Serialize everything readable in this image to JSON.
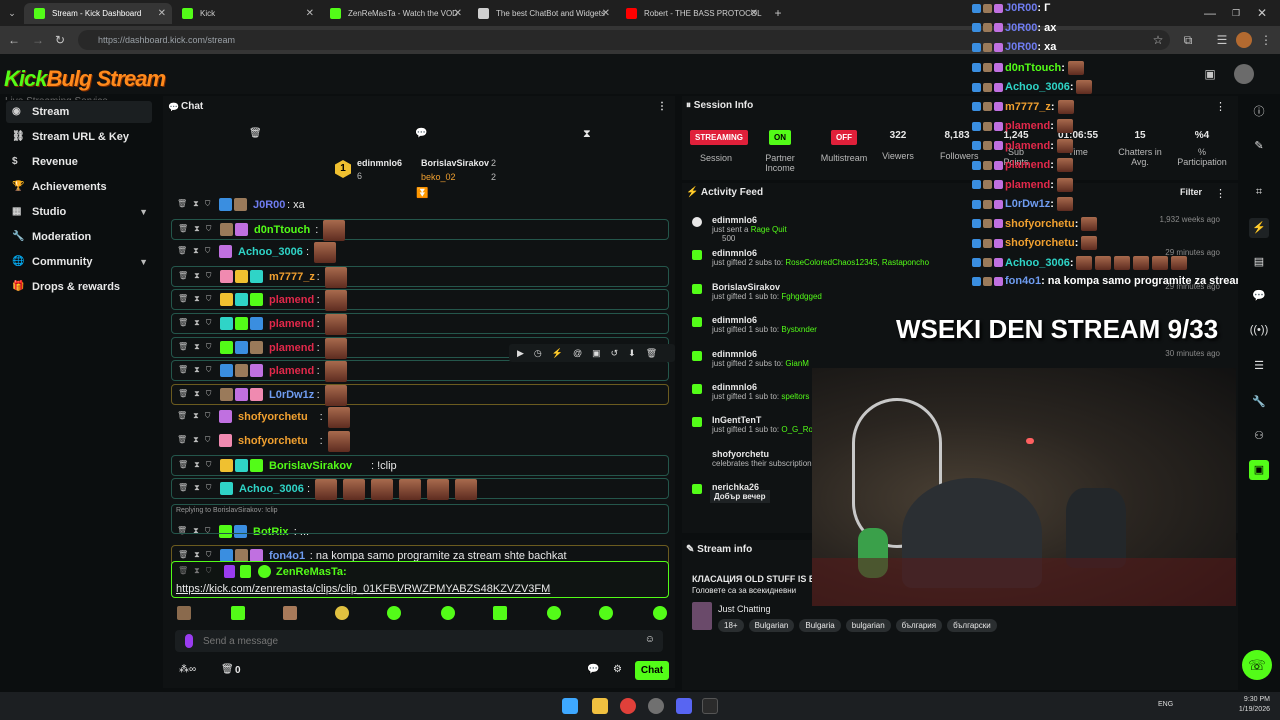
{
  "browser": {
    "tabs": [
      {
        "label": "Stream - Kick Dashboard",
        "color": "#53fc18"
      },
      {
        "label": "Kick",
        "color": "#53fc18"
      },
      {
        "label": "ZenReMasTa - Watch the VOD",
        "color": "#53fc18"
      },
      {
        "label": "The best ChatBot and Widgets",
        "color": "#d0d0d0"
      },
      {
        "label": "Robert - THE BASS PROTOCOL",
        "color": "#ff0000"
      }
    ],
    "url": "https://dashboard.kick.com/stream"
  },
  "app": {
    "logo_kick": "Kick",
    "logo_rest": "Bulg  Stream",
    "logo_sub": "Live Streaming Service"
  },
  "sidebar": {
    "items": [
      {
        "label": "Stream",
        "icon": "radio-icon"
      },
      {
        "label": "Stream URL & Key",
        "icon": "link-icon"
      },
      {
        "label": "Revenue",
        "icon": "dollar-icon"
      },
      {
        "label": "Achievements",
        "icon": "trophy-icon"
      },
      {
        "label": "Studio",
        "icon": "studio-icon"
      },
      {
        "label": "Moderation",
        "icon": "wrench-icon"
      },
      {
        "label": "Community",
        "icon": "globe-icon"
      },
      {
        "label": "Drops & rewards",
        "icon": "gift-icon"
      }
    ]
  },
  "chat": {
    "title": "Chat",
    "leader1_name": "edinmnlo6",
    "leader1_count": "6",
    "leader1_rank": "1",
    "leader2_name": "BorislavSirakov",
    "leader2_count": "2",
    "leader3_name": "beko_02",
    "leader3_count": "2",
    "messages": [
      {
        "name": "J0R00",
        "color": "#6f7cf0",
        "text": ": xa"
      },
      {
        "name": "d0nTtouch",
        "color": "#53fc18",
        "text": ":"
      },
      {
        "name": "Achoo_3006",
        "color": "#2fd4c7",
        "text": ":"
      },
      {
        "name": "m7777_z",
        "color": "#f0a030",
        "text": ":"
      },
      {
        "name": "plamend",
        "color": "#e0284a",
        "text": ":"
      },
      {
        "name": "plamend",
        "color": "#e0284a",
        "text": ":"
      },
      {
        "name": "plamend",
        "color": "#e0284a",
        "text": ":"
      },
      {
        "name": "plamend",
        "color": "#e0284a",
        "text": ":"
      },
      {
        "name": "L0rDw1z",
        "color": "#6f9cf0",
        "text": ":"
      },
      {
        "name": "shofyorchetu",
        "color": "#f0a030",
        "text": ":"
      },
      {
        "name": "shofyorchetu",
        "color": "#f0a030",
        "text": ":"
      },
      {
        "name": "BorislavSirakov",
        "color": "#53fc18",
        "text": ": !clip"
      },
      {
        "name": "Achoo_3006",
        "color": "#2fd4c7",
        "text": ":"
      },
      {
        "name": "BotRix",
        "color": "#53fc18",
        "text": ": ..."
      },
      {
        "name": "fon4o1",
        "color": "#6f9cf0",
        "text": ": na kompa samo programite za stream shte bachkat"
      }
    ],
    "reply_to": "Replying to BorislavSirakov: !clip",
    "last_name": "ZenReMasTa:",
    "last_link": "https://kick.com/zenremasta/clips/clip_01KFBVRWZPMYABZS48KZVZV3FM",
    "input_placeholder": "Send a message",
    "footer_count": "0",
    "chat_button": "Chat"
  },
  "session": {
    "title": "Session Info",
    "streaming_label": "STREAMING",
    "session_label": "Session",
    "on_label": "ON",
    "partner_label": "Partner Income",
    "off_label": "OFF",
    "multistream_label": "Multistream",
    "viewers_value": "322",
    "viewers_label": "Viewers",
    "followers_value": "8,183",
    "followers_label": "Followers",
    "subs_value": "1,245",
    "subs_label": "Sub Points",
    "time_value": "01:06:55",
    "time_label": "Time",
    "chatters_value": "15",
    "chatters_label": "Chatters in Avg.",
    "part_value": "%4",
    "part_label": "% Participation"
  },
  "activity": {
    "title": "Activity Feed",
    "filter_label": "Filter",
    "items": [
      {
        "who": "edinmnlo6",
        "what": "just sent a ",
        "target": "Rage Quit",
        "extra": "500",
        "when": "1,932 weeks ago"
      },
      {
        "who": "edinmnlo6",
        "what": "just gifted 2 subs to: ",
        "target": "RoseColoredChaos12345, Rastaponcho",
        "when": "29 minutes ago"
      },
      {
        "who": "BorislavSirakov",
        "what": "just gifted 1 sub to: ",
        "target": "Fghgdgged",
        "when": "29 minutes ago"
      },
      {
        "who": "edinmnlo6",
        "what": "just gifted 1 sub to: ",
        "target": "Bystxnder",
        "when": ""
      },
      {
        "who": "edinmnlo6",
        "what": "just gifted 2 subs to: ",
        "target": "GianM",
        "when": "30 minutes ago"
      },
      {
        "who": "edinmnlo6",
        "what": "just gifted 1 sub to: ",
        "target": "speltors",
        "when": ""
      },
      {
        "who": "InGentTenT",
        "what": "just gifted 1 sub to: ",
        "target": "O_G_Roc",
        "when": ""
      },
      {
        "who": "shofyorchetu",
        "what": "celebrates their subscription",
        "target": "",
        "when": ""
      },
      {
        "who": "nerichka26",
        "what": "",
        "target": "",
        "when": ""
      }
    ],
    "celebrate_msg": "Добър вечер"
  },
  "streaminfo": {
    "title": "Stream info",
    "line1": "КЛАСАЦИЯ OLD STUFF IS B",
    "line2": "Головете са за всекидневни",
    "category": "Just Chatting",
    "tags": [
      "18+",
      "Bulgarian",
      "Bulgaria",
      "bulgarian",
      "българия",
      "български"
    ]
  },
  "overlay": {
    "title": "WSEKI DEN STREAM 9/33",
    "chat": [
      {
        "name": "J0R00",
        "text": ": Г",
        "color": "#6f7cf0",
        "emotes": 0
      },
      {
        "name": "J0R00",
        "text": ": ах",
        "color": "#6f7cf0",
        "emotes": 0
      },
      {
        "name": "J0R00",
        "text": ": xa",
        "color": "#6f7cf0",
        "emotes": 0
      },
      {
        "name": "d0nTtouch",
        "text": ":",
        "color": "#53fc18",
        "emotes": 1
      },
      {
        "name": "Achoo_3006",
        "text": ":",
        "color": "#2fd4c7",
        "emotes": 1
      },
      {
        "name": "m7777_z",
        "text": ":",
        "color": "#f0a030",
        "emotes": 1
      },
      {
        "name": "plamend",
        "text": ":",
        "color": "#e0284a",
        "emotes": 1
      },
      {
        "name": "plamend",
        "text": ":",
        "color": "#e0284a",
        "emotes": 1
      },
      {
        "name": "plamend",
        "text": ":",
        "color": "#e0284a",
        "emotes": 1
      },
      {
        "name": "plamend",
        "text": ":",
        "color": "#e0284a",
        "emotes": 1
      },
      {
        "name": "L0rDw1z",
        "text": ":",
        "color": "#6f9cf0",
        "emotes": 1
      },
      {
        "name": "shofyorchetu",
        "text": ":",
        "color": "#f0a030",
        "emotes": 1
      },
      {
        "name": "shofyorchetu",
        "text": ":",
        "color": "#f0a030",
        "emotes": 1
      },
      {
        "name": "Achoo_3006",
        "text": ":",
        "color": "#2fd4c7",
        "emotes": 6
      },
      {
        "name": "fon4o1",
        "text": ": na kompa samo programite za stream shte bachkat",
        "color": "#6f9cf0",
        "emotes": 0
      }
    ]
  },
  "taskbar": {
    "lang": "ENG",
    "time": "9:30 PM",
    "date": "1/19/2026"
  }
}
